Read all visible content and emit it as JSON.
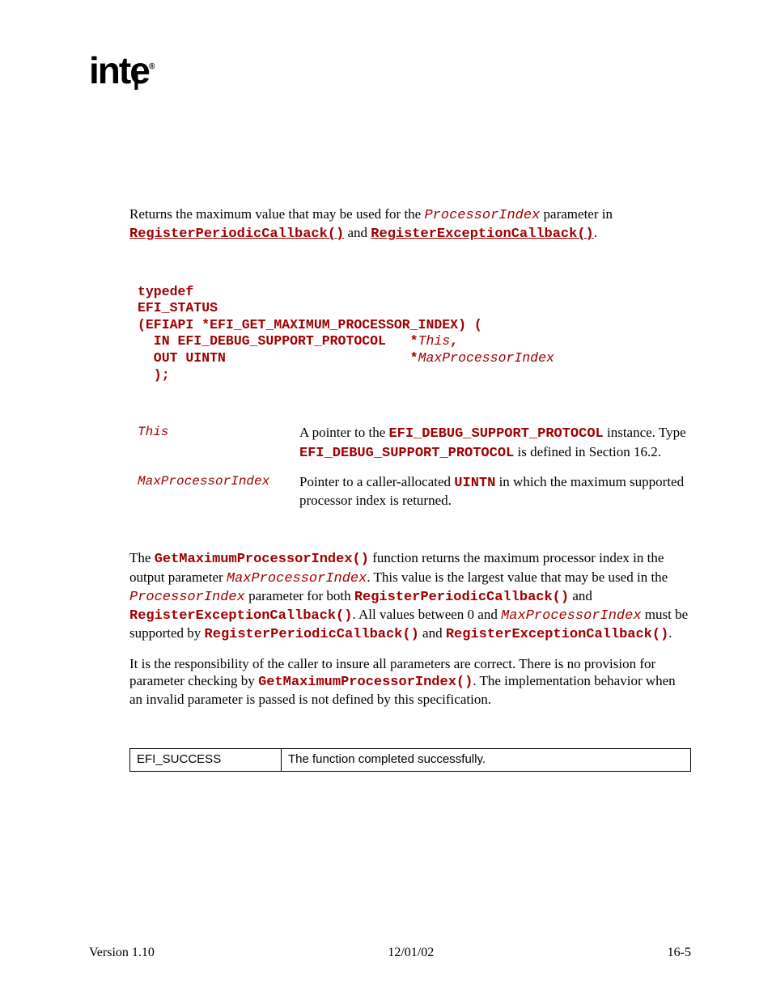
{
  "logo": "intel",
  "summary": {
    "pre": "Returns the maximum value that may be used for the ",
    "param": "ProcessorIndex",
    "mid": " parameter in ",
    "link1": "RegisterPeriodicCallback()",
    "conj": " and ",
    "link2": "RegisterExceptionCallback()",
    "post": "."
  },
  "code": "typedef\nEFI_STATUS\n(EFIAPI *EFI_GET_MAXIMUM_PROCESSOR_INDEX) (\n  IN EFI_DEBUG_SUPPORT_PROTOCOL   *<i>This</i>,\n  OUT UINTN                       *<i>MaxProcessorIndex</i>\n  );",
  "params": [
    {
      "name": "This",
      "desc_pre": "A pointer to the ",
      "desc_code1": "EFI_DEBUG_SUPPORT_PROTOCOL",
      "desc_mid": " instance. Type ",
      "desc_code2": "EFI_DEBUG_SUPPORT_PROTOCOL",
      "desc_post": " is defined in Section 16.2."
    },
    {
      "name": "MaxProcessorIndex",
      "desc_pre": "Pointer to a caller-allocated ",
      "desc_code1": "UINTN",
      "desc_post": " in which the maximum supported processor index is returned."
    }
  ],
  "description": {
    "p1": {
      "t1": "The ",
      "c1": "GetMaximumProcessorIndex()",
      "t2": " function returns the maximum processor index in the output parameter ",
      "i1": "MaxProcessorIndex",
      "t3": ".  This value is the largest value that may be used in the ",
      "i2": "ProcessorIndex",
      "t4": " parameter for both ",
      "c2": "RegisterPeriodicCallback()",
      "t5": " and ",
      "c3": "RegisterExceptionCallback()",
      "t6": ".  All values between 0 and ",
      "i3": "MaxProcessorIndex",
      "t7": " must be supported by ",
      "c4": "RegisterPeriodicCallback()",
      "t8": " and ",
      "c5": "RegisterExceptionCallback()",
      "t9": "."
    },
    "p2": {
      "t1": "It is the responsibility of the caller to insure all parameters are correct.  There is no provision for parameter checking by ",
      "c1": "GetMaximumProcessorIndex()",
      "t2": ".  The implementation behavior when an invalid parameter is passed is not defined by this specification."
    }
  },
  "status": {
    "code": "EFI_SUCCESS",
    "text": "The function completed successfully."
  },
  "footer": {
    "left": "Version 1.10",
    "center": "12/01/02",
    "right": "16-5"
  }
}
